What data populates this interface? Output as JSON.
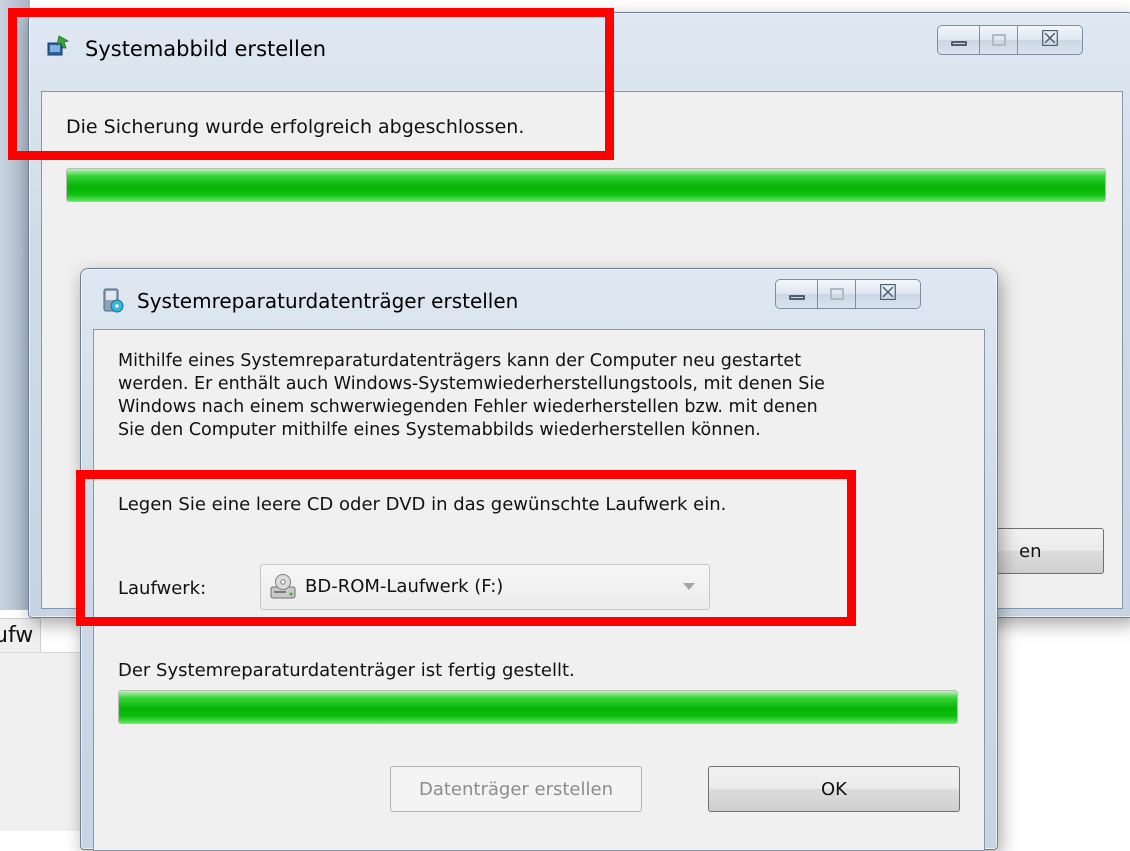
{
  "background": {
    "partial_label": "ufw"
  },
  "main_window": {
    "title": "Systemabbild erstellen",
    "status": "Die Sicherung wurde erfolgreich abgeschlossen.",
    "progress_percent": 100,
    "partial_button_label": "en",
    "icon": "backup-icon"
  },
  "repair_dialog": {
    "title": "Systemreparaturdatenträger erstellen",
    "icon": "disc-repair-icon",
    "description_lines": [
      "Mithilfe eines Systemreparaturdatenträgers kann der Computer neu gestartet",
      "werden. Er enthält auch Windows-Systemwiederherstellungstools, mit denen Sie",
      "Windows nach einem schwerwiegenden Fehler wiederherstellen bzw. mit denen",
      "Sie den Computer mithilfe eines Systemabbilds wiederherstellen können."
    ],
    "instruction": "Legen Sie eine leere CD oder DVD in das gewünschte Laufwerk ein.",
    "drive_label": "Laufwerk:",
    "drive_value": "BD-ROM-Laufwerk (F:)",
    "drive_icon": "optical-drive-icon",
    "status": "Der Systemreparaturdatenträger ist fertig gestellt.",
    "progress_percent": 100,
    "create_button": "Datenträger erstellen",
    "ok_button": "OK"
  },
  "colors": {
    "annotation": "#ff0000",
    "progress": "#06b306"
  }
}
